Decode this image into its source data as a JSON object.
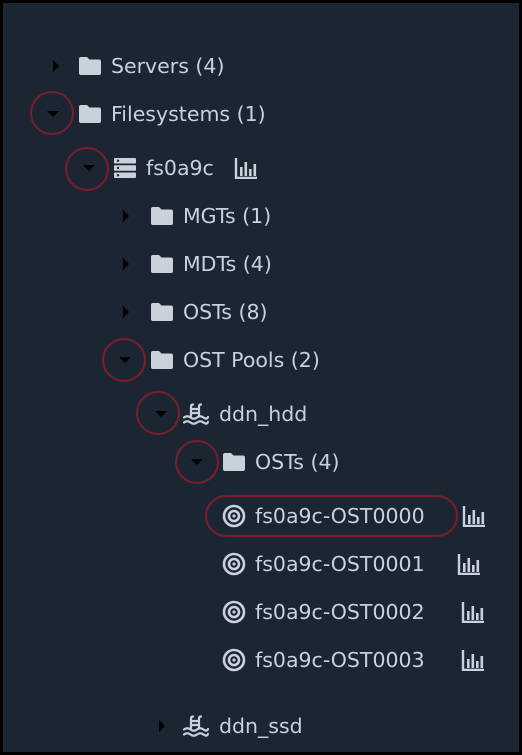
{
  "tree": {
    "servers": {
      "label": "Servers (4)",
      "icon": "folder-icon"
    },
    "filesystems": {
      "label": "Filesystems (1)",
      "icon": "folder-icon"
    },
    "fs": {
      "label": "fs0a9c",
      "icon": "server-stack-icon",
      "chart_icon": "bar-chart-icon"
    },
    "mgts": {
      "label": "MGTs (1)",
      "icon": "folder-icon"
    },
    "mdts": {
      "label": "MDTs (4)",
      "icon": "folder-icon"
    },
    "osts": {
      "label": "OSTs (8)",
      "icon": "folder-icon"
    },
    "ost_pools": {
      "label": "OST Pools (2)",
      "icon": "folder-icon"
    },
    "pool_hdd": {
      "label": "ddn_hdd",
      "icon": "pool-icon"
    },
    "pool_hdd_osts": {
      "label": "OSTs (4)",
      "icon": "folder-icon"
    },
    "targets": [
      {
        "label": "fs0a9c-OST0000",
        "icon": "target-icon",
        "chart_icon": "bar-chart-icon"
      },
      {
        "label": "fs0a9c-OST0001",
        "icon": "target-icon",
        "chart_icon": "bar-chart-icon"
      },
      {
        "label": "fs0a9c-OST0002",
        "icon": "target-icon",
        "chart_icon": "bar-chart-icon"
      },
      {
        "label": "fs0a9c-OST0003",
        "icon": "target-icon",
        "chart_icon": "bar-chart-icon"
      }
    ],
    "pool_ssd": {
      "label": "ddn_ssd",
      "icon": "pool-icon"
    }
  },
  "colors": {
    "background": "#1c2633",
    "text": "#c9d1db",
    "highlight": "#7d1d2b",
    "frame": "#000000"
  }
}
